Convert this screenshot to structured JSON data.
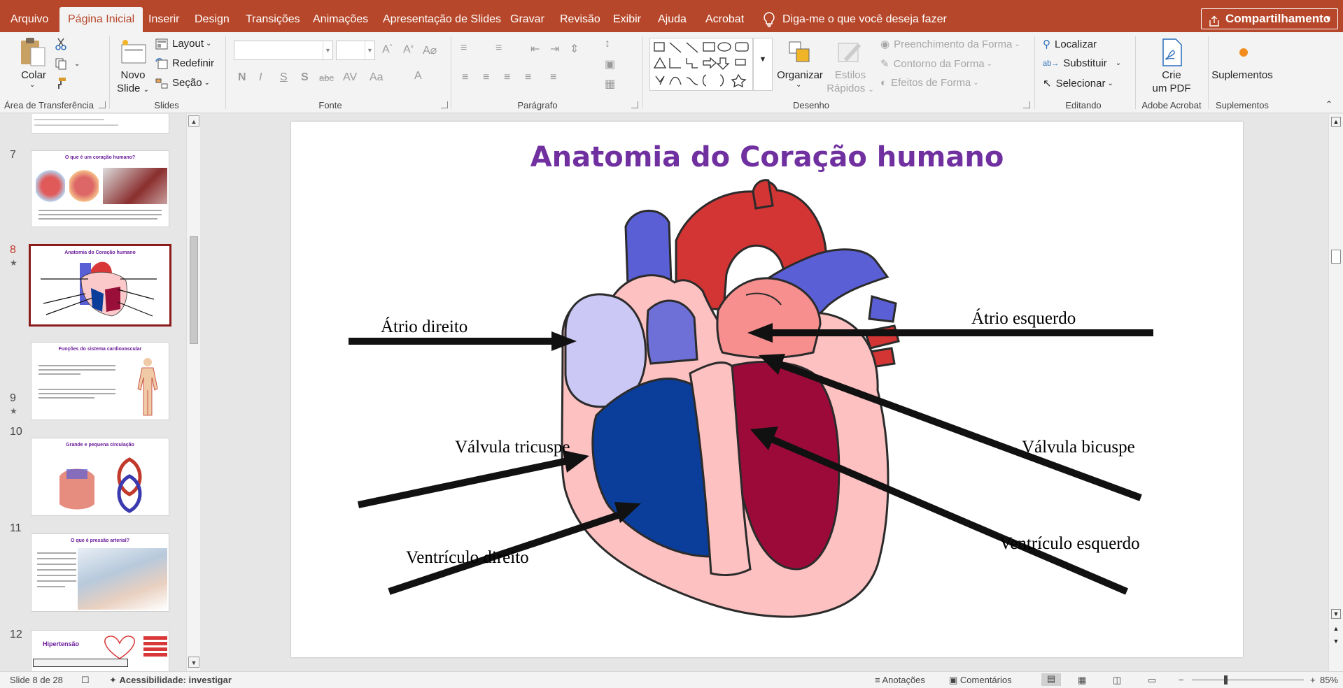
{
  "tabs": [
    {
      "label": "Arquivo"
    },
    {
      "label": "Página Inicial",
      "active": true
    },
    {
      "label": "Inserir"
    },
    {
      "label": "Design"
    },
    {
      "label": "Transições"
    },
    {
      "label": "Animações"
    },
    {
      "label": "Apresentação de Slides"
    },
    {
      "label": "Gravar"
    },
    {
      "label": "Revisão"
    },
    {
      "label": "Exibir"
    },
    {
      "label": "Ajuda"
    },
    {
      "label": "Acrobat"
    }
  ],
  "tell_me": "Diga-me o que você deseja fazer",
  "share_label": "Compartilhamento",
  "ribbon": {
    "clipboard": {
      "paste": "Colar",
      "group": "Área de Transferência"
    },
    "slides": {
      "new_slide_1": "Novo",
      "new_slide_2": "Slide",
      "layout": "Layout",
      "reset": "Redefinir",
      "section": "Seção",
      "group": "Slides"
    },
    "font": {
      "group": "Fonte"
    },
    "paragraph": {
      "group": "Parágrafo"
    },
    "drawing": {
      "arrange": "Organizar",
      "quick_styles_1": "Estilos",
      "quick_styles_2": "Rápidos",
      "shape_fill": "Preenchimento da Forma",
      "shape_outline": "Contorno da Forma",
      "shape_effects": "Efeitos de Forma",
      "group": "Desenho"
    },
    "editing": {
      "find": "Localizar",
      "replace": "Substituir",
      "select": "Selecionar",
      "group": "Editando"
    },
    "acrobat": {
      "create_pdf_1": "Crie",
      "create_pdf_2": "um PDF",
      "group": "Adobe Acrobat"
    },
    "addins": {
      "label": "Suplementos",
      "group": "Suplementos"
    }
  },
  "thumbnails": [
    {
      "num": "7",
      "title": "O que é um coração humano?"
    },
    {
      "num": "8",
      "title": "Anatomia do Coração humano",
      "selected": true,
      "star": "★"
    },
    {
      "num": "9",
      "title": "Funções do sistema cardiovascular",
      "star": "★"
    },
    {
      "num": "10",
      "title": "Grande e pequena circulação"
    },
    {
      "num": "11",
      "title": "O que é pressão arterial?"
    },
    {
      "num": "12",
      "title": "Hipertensão"
    }
  ],
  "slide": {
    "title": "Anatomia do Coração humano",
    "labels": {
      "atrio_direito": "Átrio direito",
      "atrio_esquerdo": "Átrio esquerdo",
      "valvula_tricuspe": "Válvula tricuspe",
      "valvula_bicuspe": "Válvula bicuspe",
      "ventriculo_direito": "Ventrículo direito",
      "ventriculo_esquerdo": "Ventrículo esquerdo"
    }
  },
  "status": {
    "slide_count": "Slide 8 de 28",
    "accessibility": "Acessibilidade: investigar",
    "notes": "Anotações",
    "comments": "Comentários",
    "zoom": "85%"
  },
  "colors": {
    "accent": "#b7472a",
    "title": "#7030a0",
    "selected_thumb": "#8b1a1a"
  }
}
